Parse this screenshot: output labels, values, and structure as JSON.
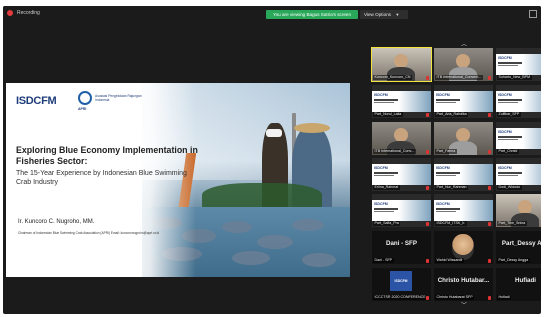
{
  "topbar": {
    "recording_label": "Recording",
    "viewing_banner": "You are viewing Bagus Satria's screen",
    "view_options_label": "View Options",
    "view_options_chevron": "▾"
  },
  "shared_slide": {
    "logo_primary": "ISDCFM",
    "logo_secondary": "Asosiasi Pengelolaan Rajungan Indonesia",
    "logo_secondary_short": "APRI",
    "title": "Exploring Blue Economy Implementation in Fisheries Sector:",
    "subtitle": "The 15-Year Experience by Indonesian Blue Swimming Crab Industry",
    "presenter": "Ir. Kuncoro C. Nugroho, MM.",
    "presenter_role": "Chairman of Indonesian Blue Swimming Crab Association (APRI) Email: kuncoronugroho@apri.or.id"
  },
  "gallery": {
    "scroll_up": "︿",
    "scroll_down": "﹀",
    "tiles": [
      {
        "label": "Kuncoro_Kuncoro_CN",
        "big": ""
      },
      {
        "label": "ITB International_Convent...",
        "big": ""
      },
      {
        "label": "Suharto_New_BPM",
        "big": ""
      },
      {
        "label": "Part_Nurul_Laila",
        "big": ""
      },
      {
        "label": "Part_Aria_Rahdika",
        "big": ""
      },
      {
        "label": "Zulfikar_SFP",
        "big": ""
      },
      {
        "label": "ITB International_Conv...",
        "big": ""
      },
      {
        "label": "Part_Fatma",
        "big": ""
      },
      {
        "label": "Part_Christi",
        "big": ""
      },
      {
        "label": "Erlina_Rahmat",
        "big": ""
      },
      {
        "label": "Part_Nur_Rahman",
        "big": ""
      },
      {
        "label": "Dodi_Widodo",
        "big": ""
      },
      {
        "label": "Part_Salfa_Pra",
        "big": ""
      },
      {
        "label": "ISDCFM_ITSK_Ir.",
        "big": ""
      },
      {
        "label": "Part_Tine_Snina",
        "big": ""
      },
      {
        "label": "Dani - SFP",
        "big": "Dani - SFP"
      },
      {
        "label": "Wahid Wissandi",
        "big": ""
      },
      {
        "label": "Part_Dessy Angga",
        "big": "Part_Dessy Ang"
      },
      {
        "label": "ICCCTSR 2020 CONFERENCE",
        "big": ""
      },
      {
        "label": "Christo Hutabarat SFP",
        "big": "Christo Hutabar..."
      },
      {
        "label": "Hufiadi",
        "big": "Hufiadi"
      }
    ]
  },
  "colors": {
    "banner_green": "#2aa85a",
    "active_speaker": "#f2e43a",
    "background": "#1b1b1b"
  }
}
